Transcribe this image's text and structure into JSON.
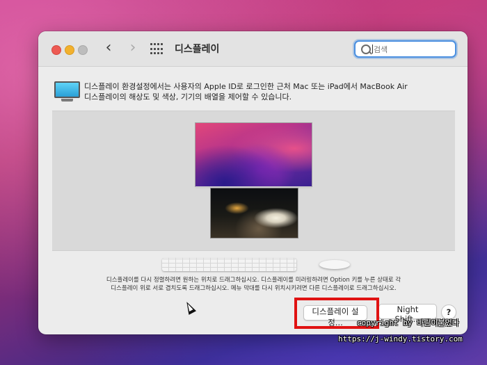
{
  "window": {
    "title": "디스플레이",
    "search_placeholder": "검색"
  },
  "info": {
    "line1": "디스플레이 환경설정에서는 사용자의 Apple ID로 로그인한 근처 Mac 또는 iPad에서 MacBook Air",
    "line2": "디스플레이의 해상도 및 색상, 기기의 배열을 제어할 수 있습니다."
  },
  "hint": {
    "line1": "디스플레이를 다시 정렬하려면 원하는 위치로 드래그하십시오. 디스플레이를 미러링하려면 Option 키를 누른 상태로 각",
    "line2": "디스플레이 위로 서로 겹치도록 드래그하십시오. 메뉴 막대를 다시 위치시키려면 다른 디스플레이로 드래그하십시오."
  },
  "buttons": {
    "display_settings": "디스플레이 설정...",
    "night_shift": "Night Shift...",
    "help": "?"
  },
  "watermark": {
    "copyright": "copyright by 바람이불었다",
    "url": "https://j-windy.tistory.com"
  },
  "colors": {
    "highlight": "#e01212",
    "search_focus": "#4a8fe0"
  }
}
